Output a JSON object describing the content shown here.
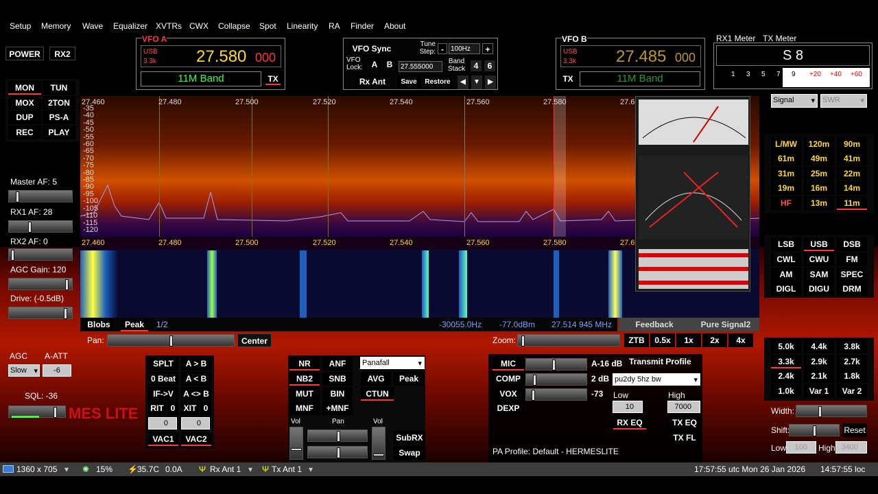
{
  "menu": [
    "Setup",
    "Memory",
    "Wave",
    "Equalizer",
    "XVTRs",
    "CWX",
    "Collapse",
    "Spot",
    "Linearity",
    "RA",
    "Finder",
    "About"
  ],
  "left": {
    "power": "POWER",
    "rx2": "RX2",
    "buttons": [
      "MON",
      "TUN",
      "MOX",
      "2TON",
      "DUP",
      "PS-A",
      "REC",
      "PLAY"
    ],
    "master_af": "Master AF:  5",
    "rx1_af": "RX1 AF:  28",
    "rx2_af": "RX2 AF:  0",
    "agc_gain": "AGC Gain:  120",
    "drive": "Drive:  (-0.5dB)",
    "agc": "AGC",
    "a_att": "A-ATT",
    "agc_value": "Slow",
    "att_value": "-6",
    "sql": "SQL:  -36",
    "logo": "MES LITE"
  },
  "vfo_a": {
    "title": "VFO A",
    "mode": "USB",
    "bw": "3.3k",
    "freq_main": "27.580",
    "freq_sub": "000",
    "band": "11M Band",
    "tx": "TX"
  },
  "vfo_mid": {
    "sync": "VFO Sync",
    "tune_step": "Tune\nStep:",
    "step": "100Hz",
    "vfo_lock": "VFO\nLock:",
    "a": "A",
    "b": "B",
    "freq": "27.555000",
    "band_stack": "Band\nStack",
    "rx_ant": "Rx Ant",
    "save": "Save",
    "restore": "Restore"
  },
  "vfo_b": {
    "title": "VFO B",
    "mode": "USB",
    "bw": "3.3k",
    "freq_main": "27.485",
    "freq_sub": "000",
    "band": "11M Band",
    "tx": "TX"
  },
  "meter": {
    "rx1": "RX1 Meter",
    "tx": "TX Meter",
    "reading": "S 8",
    "scale": [
      "1",
      "3",
      "5",
      "7",
      "9",
      "+20",
      "+40",
      "+60"
    ],
    "signal": "Signal",
    "swr": "SWR"
  },
  "spectrum": {
    "ticks_top": [
      "27.460",
      "27.480",
      "27.500",
      "27.520",
      "27.540",
      "27.560",
      "27.580",
      "27.6"
    ],
    "ticks_bottom": [
      "27.460",
      "27.480",
      "27.500",
      "27.520",
      "27.540",
      "27.560",
      "27.580",
      "27.6"
    ],
    "db": [
      "-35",
      "-40",
      "-45",
      "-50",
      "-55",
      "-60",
      "-65",
      "-70",
      "-75",
      "-80",
      "-85",
      "-90",
      "-95",
      "-100",
      "-105",
      "-110",
      "-115",
      "-120"
    ],
    "blobs": "Blobs",
    "peak": "Peak",
    "page": "1/2",
    "offset": "-30055.0Hz",
    "dbm": "-77.0dBm",
    "cursor": "27.514 945 MHz",
    "feedback": "Feedback",
    "pure": "Pure Signal2"
  },
  "bands": [
    "L/MW",
    "120m",
    "90m",
    "61m",
    "49m",
    "41m",
    "31m",
    "25m",
    "22m",
    "19m",
    "16m",
    "14m",
    "HF",
    "13m",
    "11m"
  ],
  "modes": [
    "LSB",
    "USB",
    "DSB",
    "CWL",
    "CWU",
    "FM",
    "AM",
    "SAM",
    "SPEC",
    "DIGL",
    "DIGU",
    "DRM"
  ],
  "filters": [
    "5.0k",
    "4.4k",
    "3.8k",
    "3.3k",
    "2.9k",
    "2.7k",
    "2.4k",
    "2.1k",
    "1.8k",
    "1.0k",
    "Var 1",
    "Var 2"
  ],
  "filter_ctrl": {
    "width": "Width:",
    "shift": "Shift:",
    "reset": "Reset",
    "low": "Low",
    "low_val": "100",
    "high": "High",
    "high_val": "3400"
  },
  "pan": {
    "label": "Pan:",
    "center": "Center",
    "zoom": "Zoom:",
    "zbtns": [
      "ZTB",
      "0.5x",
      "1x",
      "2x",
      "4x"
    ]
  },
  "split": [
    "SPLT",
    "A > B",
    "0 Beat",
    "A < B",
    "IF->V",
    "A <> B"
  ],
  "rit": {
    "rit": "RIT",
    "rit_v": "0",
    "xit": "XIT",
    "xit_v": "0",
    "rit_in": "0",
    "xit_in": "0",
    "vac1": "VAC1",
    "vac2": "VAC2"
  },
  "dsp": [
    "NR",
    "ANF",
    "NB2",
    "SNB",
    "MUT",
    "BIN",
    "MNF",
    "+MNF"
  ],
  "dsp2": {
    "display": "Panafall",
    "avg": "AVG",
    "peak": "Peak",
    "ctun": "CTUN",
    "vol": "Vol",
    "pan": "Pan",
    "vol2": "Vol",
    "subrx": "SubRX",
    "swap": "Swap"
  },
  "tx": {
    "mic": "MIC",
    "mic_v": "A-16 dB",
    "comp": "COMP",
    "comp_v": "2 dB",
    "vox": "VOX",
    "vox_v": "-73",
    "dexp": "DEXP",
    "profile_lbl": "Transmit Profile",
    "profile": "pu2dy 5hz bw",
    "low": "Low",
    "high": "High",
    "low_v": "10",
    "high_v": "7000",
    "rxeq": "RX EQ",
    "txeq": "TX EQ",
    "txfl": "TX FL",
    "pa": "PA Profile: Default - HERMESLITE"
  },
  "status": {
    "res": "1360 x 705",
    "cpu": "15%",
    "temp": "35.7C",
    "amp": "0.0A",
    "rxant": "Rx Ant  1",
    "txant": "Tx Ant  1",
    "utc": "17:57:55 utc  Mon 26 Jan 2026",
    "loc": "14:57:55 loc"
  },
  "colors": {
    "vfo_freq": "#ffd83a",
    "band": "#3cff3c",
    "accent_red": "#ff3a3a"
  }
}
